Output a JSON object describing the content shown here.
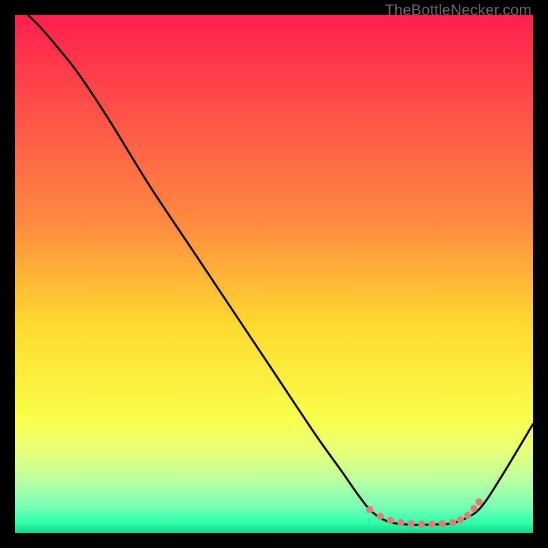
{
  "watermark": "TheBottleNecker.com",
  "chart_data": {
    "type": "line",
    "title": "",
    "xlabel": "",
    "ylabel": "",
    "xlim": [
      0,
      100
    ],
    "ylim": [
      0,
      100
    ],
    "gradient_colors": [
      {
        "offset": 0.0,
        "color": "#ff1f4f"
      },
      {
        "offset": 0.4,
        "color": "#fe8a40"
      },
      {
        "offset": 0.6,
        "color": "#feda2e"
      },
      {
        "offset": 0.78,
        "color": "#faff4a"
      },
      {
        "offset": 0.84,
        "color": "#e9ff77"
      },
      {
        "offset": 0.9,
        "color": "#b9ffa1"
      },
      {
        "offset": 0.95,
        "color": "#77ffb6"
      },
      {
        "offset": 0.98,
        "color": "#2fffab"
      },
      {
        "offset": 1.0,
        "color": "#12d886"
      }
    ],
    "series": [
      {
        "name": "curve",
        "points": [
          {
            "x": 2.5,
            "y": 100.0
          },
          {
            "x": 5.0,
            "y": 97.5
          },
          {
            "x": 8.0,
            "y": 94.0
          },
          {
            "x": 12.0,
            "y": 89.0
          },
          {
            "x": 18.0,
            "y": 80.0
          },
          {
            "x": 26.0,
            "y": 67.0
          },
          {
            "x": 34.0,
            "y": 55.0
          },
          {
            "x": 42.0,
            "y": 43.0
          },
          {
            "x": 50.0,
            "y": 31.0
          },
          {
            "x": 58.0,
            "y": 19.0
          },
          {
            "x": 63.0,
            "y": 12.0
          },
          {
            "x": 66.5,
            "y": 7.0
          },
          {
            "x": 69.0,
            "y": 4.0
          },
          {
            "x": 72.0,
            "y": 2.2
          },
          {
            "x": 76.0,
            "y": 1.6
          },
          {
            "x": 80.0,
            "y": 1.6
          },
          {
            "x": 84.0,
            "y": 1.8
          },
          {
            "x": 87.0,
            "y": 2.8
          },
          {
            "x": 90.0,
            "y": 5.0
          },
          {
            "x": 94.0,
            "y": 11.0
          },
          {
            "x": 100.0,
            "y": 21.0
          }
        ]
      }
    ],
    "markers": [
      {
        "x": 68.5,
        "y": 4.5
      },
      {
        "x": 70.5,
        "y": 3.2
      },
      {
        "x": 72.5,
        "y": 2.4
      },
      {
        "x": 74.5,
        "y": 2.0
      },
      {
        "x": 76.5,
        "y": 1.8
      },
      {
        "x": 78.5,
        "y": 1.7
      },
      {
        "x": 80.5,
        "y": 1.7
      },
      {
        "x": 82.5,
        "y": 1.8
      },
      {
        "x": 84.5,
        "y": 2.0
      },
      {
        "x": 86.0,
        "y": 2.5
      },
      {
        "x": 87.4,
        "y": 3.4
      },
      {
        "x": 88.6,
        "y": 4.7
      },
      {
        "x": 89.6,
        "y": 6.0
      }
    ],
    "marker_color": "#e77a74",
    "marker_radius": 5.2
  }
}
